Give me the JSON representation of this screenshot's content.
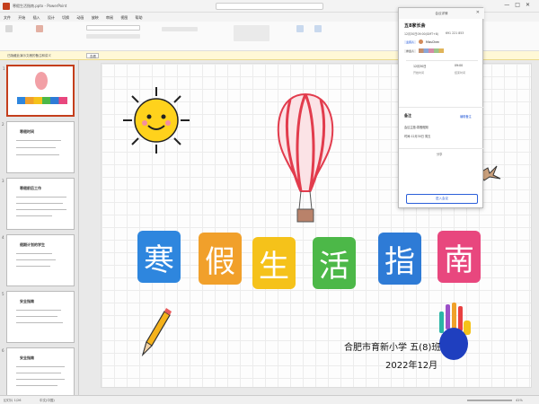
{
  "app": {
    "window_title": "寒假生活指南.pptx - PowerPoint",
    "search_placeholder": "搜索"
  },
  "menu": [
    "文件",
    "开始",
    "插入",
    "设计",
    "切换",
    "动画",
    "放映",
    "审阅",
    "视图",
    "帮助"
  ],
  "notice": {
    "text": "已隐藏此演示文稿的备注和讲义",
    "button": "查看"
  },
  "thumbnails": [
    {
      "num": "1",
      "title": ""
    },
    {
      "num": "2",
      "title": "寒假时间"
    },
    {
      "num": "3",
      "title": "寒假前后工作"
    },
    {
      "num": "4",
      "title": "假期计划的学生"
    },
    {
      "num": "5",
      "title": "安全指南"
    },
    {
      "num": "6",
      "title": "安全指南"
    }
  ],
  "slide": {
    "chars": [
      "寒",
      "假",
      "生",
      "活",
      "指",
      "南"
    ],
    "school": "合肥市育新小学 五(8)班",
    "date": "2022年12月"
  },
  "meeting": {
    "header": "会议详情",
    "title": "五8家长会",
    "time": "12月30日09:00(GMT+8)",
    "meeting_id": "691 221 853",
    "host_label": "主持人",
    "host": "MissChen",
    "participants_label": "参会人",
    "start": "12月30日",
    "end": "09:00",
    "start_label": "开始时间",
    "end_label": "结束时间",
    "notes_header": "备注",
    "notes_edit": "编辑备注",
    "notes_line1": "会议主题:寒假假期",
    "notes_line2": "时间:12月30日 周五",
    "join_button": "进入会议",
    "share": "分享"
  },
  "status": {
    "slide_info": "幻灯片 1/26",
    "lang": "中文(中国)",
    "zoom": "41%"
  },
  "colors": {
    "tile1": "#2e86de",
    "tile2": "#f1a02b",
    "tile3": "#f5c21a",
    "tile4": "#4cb848",
    "tile5": "#2e7bd6",
    "tile6": "#e8477e",
    "accent": "#c43e1c"
  }
}
